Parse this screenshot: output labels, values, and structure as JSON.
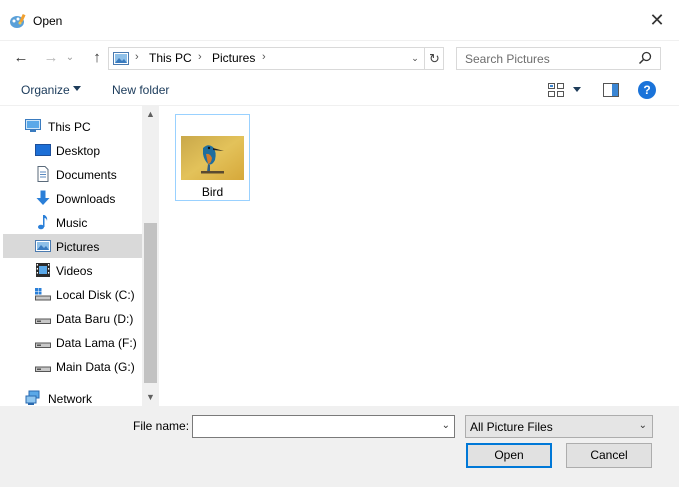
{
  "window": {
    "title": "Open",
    "close_glyph": "✕"
  },
  "nav": {
    "back_glyph": "←",
    "forward_glyph": "→",
    "recent_glyph": "⌄",
    "up_glyph": "↑",
    "breadcrumb": [
      "This PC",
      "Pictures"
    ],
    "crumb_sep": "›",
    "dropdown_glyph": "⌄",
    "refresh_glyph": "↻"
  },
  "search": {
    "placeholder": "Search Pictures"
  },
  "toolbar": {
    "organize_label": "Organize",
    "new_folder_label": "New folder",
    "help_label": "?"
  },
  "sidebar": {
    "items": [
      {
        "label": "This PC",
        "icon": "computer-icon"
      },
      {
        "label": "Desktop",
        "icon": "desktop-icon"
      },
      {
        "label": "Documents",
        "icon": "documents-icon"
      },
      {
        "label": "Downloads",
        "icon": "downloads-icon"
      },
      {
        "label": "Music",
        "icon": "music-icon"
      },
      {
        "label": "Pictures",
        "icon": "pictures-icon",
        "selected": true
      },
      {
        "label": "Videos",
        "icon": "videos-icon"
      },
      {
        "label": "Local Disk (C:)",
        "icon": "system-drive-icon"
      },
      {
        "label": "Data Baru (D:)",
        "icon": "drive-icon"
      },
      {
        "label": "Data Lama (F:)",
        "icon": "drive-icon"
      },
      {
        "label": "Main Data (G:)",
        "icon": "drive-icon"
      },
      {
        "label": "Network",
        "icon": "network-icon"
      }
    ]
  },
  "files": [
    {
      "name": "Bird",
      "thumbnail": "bird-image"
    }
  ],
  "bottom": {
    "file_name_label": "File name:",
    "file_name_value": "",
    "filter_value": "All Picture Files",
    "open_label": "Open",
    "cancel_label": "Cancel",
    "caret_glyph": "⌄"
  },
  "colors": {
    "accent": "#0078d7",
    "selection": "#d9d9d9",
    "item_border": "#99d1ff",
    "help": "#1a73d9"
  }
}
